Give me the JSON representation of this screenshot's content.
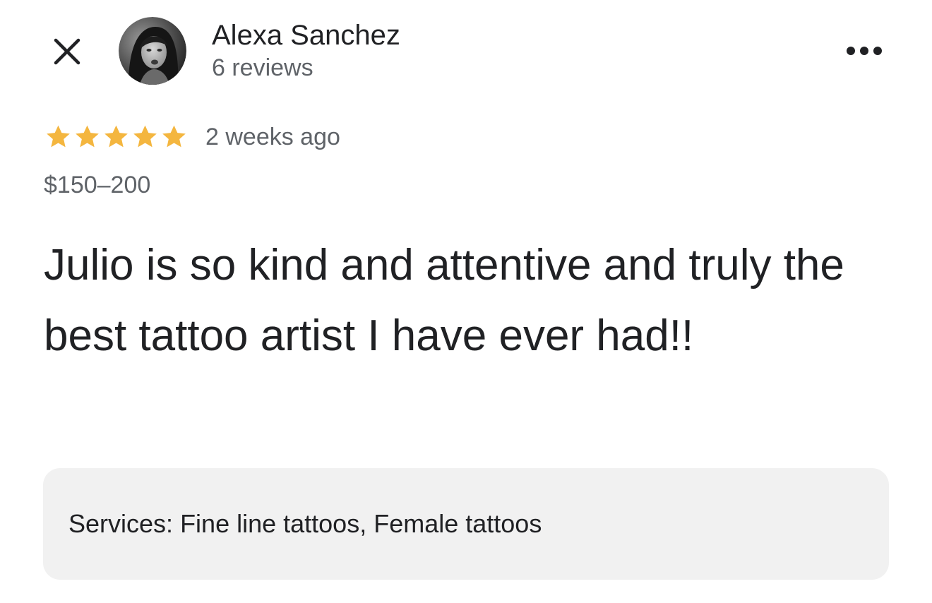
{
  "header": {
    "close_icon": "close-icon",
    "more_icon": "more-horizontal-icon",
    "reviewer_name": "Alexa Sanchez",
    "review_count": "6 reviews"
  },
  "review": {
    "rating": 5,
    "rating_max": 5,
    "star_color": "#f4b63f",
    "time_ago": "2 weeks ago",
    "price_range": "$150–200",
    "text": "Julio is so kind and attentive and truly the best tattoo artist I have ever had!!",
    "services_label": "Services:",
    "services_value": "Fine line tattoos, Female tattoos"
  }
}
